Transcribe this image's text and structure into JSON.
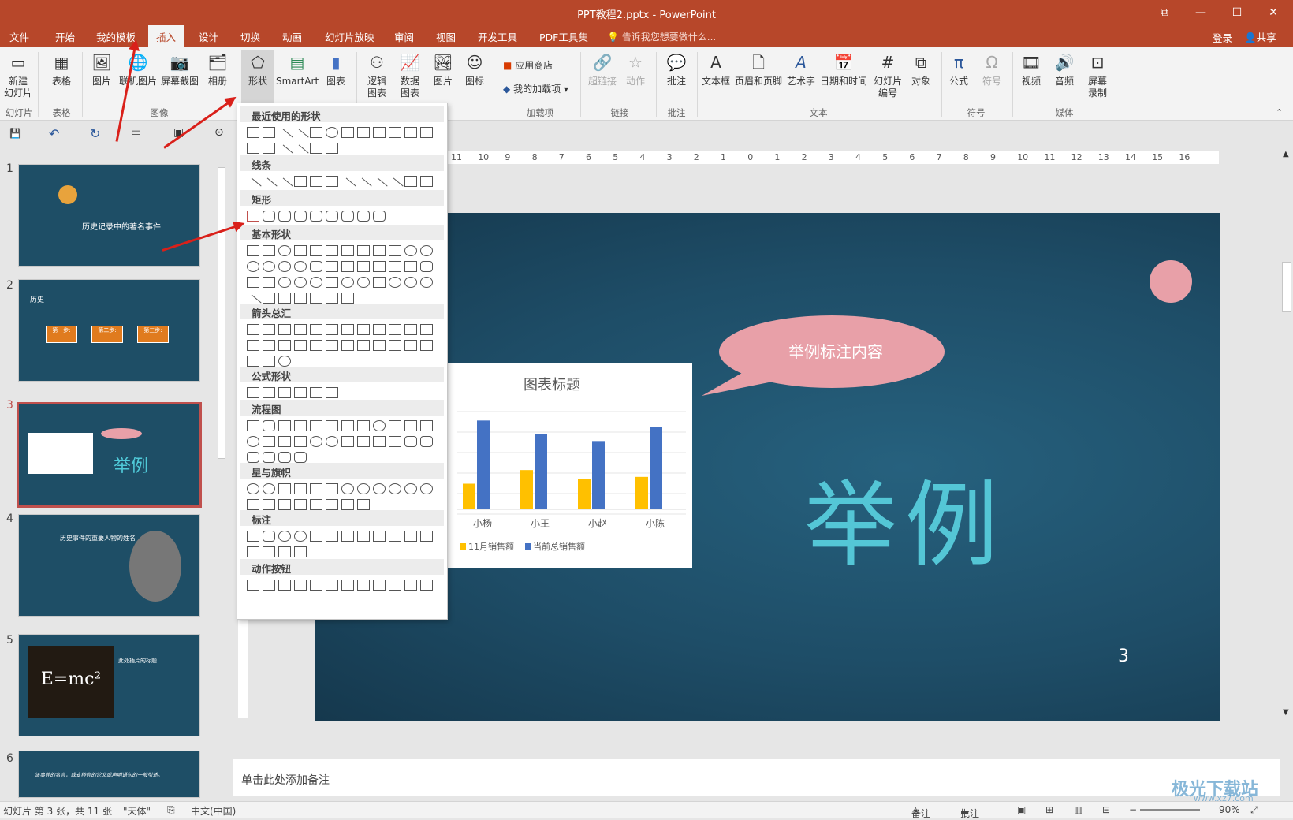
{
  "window": {
    "title": "PPT教程2.pptx - PowerPoint",
    "restore": "⧉",
    "minimize": "—",
    "maximize": "☐",
    "close": "✕"
  },
  "menu": {
    "tabs": [
      "文件",
      "开始",
      "我的模板",
      "插入",
      "设计",
      "切换",
      "动画",
      "幻灯片放映",
      "审阅",
      "视图",
      "开发工具",
      "PDF工具集"
    ],
    "active": "插入",
    "tellme": "告诉我您想要做什么...",
    "login": "登录",
    "share": "共享"
  },
  "ribbon": {
    "new_slide": "新建\n幻灯片",
    "table": "表格",
    "picture": "图片",
    "online_picture": "联机图片",
    "screenshot": "屏幕截图",
    "album": "相册",
    "shapes": "形状",
    "smartart": "SmartArt",
    "chart": "图表",
    "logic_chart": "逻辑\n图表",
    "data_chart": "数据\n图表",
    "img": "图片",
    "icon": "图标",
    "store": "应用商店",
    "my_addins": "我的加载项",
    "hyperlink": "超链接",
    "action": "动作",
    "comment": "批注",
    "textbox": "文本框",
    "header_footer": "页眉和页脚",
    "wordart": "艺术字",
    "datetime": "日期和时间",
    "slide_number": "幻灯片\n编号",
    "object": "对象",
    "equation": "公式",
    "symbol": "符号",
    "video": "视频",
    "audio": "音频",
    "screen_record": "屏幕\n录制",
    "groups": {
      "slides": "幻灯片",
      "tables": "表格",
      "images": "图像",
      "addins": "加载项",
      "links": "链接",
      "comments": "批注",
      "text": "文本",
      "symbols": "符号",
      "media": "媒体"
    }
  },
  "shapes_menu": {
    "recent": "最近使用的形状",
    "lines": "线条",
    "rects": "矩形",
    "basic": "基本形状",
    "arrows": "箭头总汇",
    "equation": "公式形状",
    "flowchart": "流程图",
    "stars": "星与旗帜",
    "callouts": "标注",
    "action_buttons": "动作按钮"
  },
  "thumbnails": [
    {
      "num": "1",
      "title": "历史记录中的著名事件"
    },
    {
      "num": "2",
      "title": "历史",
      "steps": [
        "第一步:",
        "第二步:",
        "第三步:"
      ]
    },
    {
      "num": "3",
      "title": "举例"
    },
    {
      "num": "4",
      "title": "历史事件的重要人物的姓名"
    },
    {
      "num": "5",
      "title": "此处插片的标题",
      "formula": "E=mc²"
    },
    {
      "num": "6",
      "title": "该事件的名言，或支持你的论文或声明语句的一般引述。"
    }
  ],
  "slide": {
    "callout": "举例标注内容",
    "title": "举例",
    "page": "3"
  },
  "chart_data": {
    "type": "bar",
    "title": "图表标题",
    "categories": [
      "小杨",
      "小王",
      "小赵",
      "小陈"
    ],
    "series": [
      {
        "name": "11月销售额",
        "values": [
          15,
          23,
          18,
          19
        ],
        "color": "#ffc000"
      },
      {
        "name": "当前总销售额",
        "values": [
          52,
          44,
          40,
          48
        ],
        "color": "#4472c4"
      }
    ],
    "ylim": [
      0,
      60
    ],
    "legend": "bottom"
  },
  "ruler": {
    "ticks": [
      "11",
      "10",
      "9",
      "8",
      "7",
      "6",
      "5",
      "4",
      "3",
      "2",
      "1",
      "0",
      "1",
      "2",
      "3",
      "4",
      "5",
      "6",
      "7",
      "8",
      "9",
      "10",
      "11",
      "12",
      "13",
      "14",
      "15",
      "16"
    ]
  },
  "notes": {
    "placeholder": "单击此处添加备注"
  },
  "status": {
    "slide_info": "幻灯片 第 3 张，共 11 张",
    "theme": "\"天体\"",
    "lang": "中文(中国)",
    "notes": "备注",
    "comments": "批注",
    "zoom": "90%"
  },
  "watermark": {
    "text": "极光下载站",
    "url": "www.xz7.com"
  }
}
